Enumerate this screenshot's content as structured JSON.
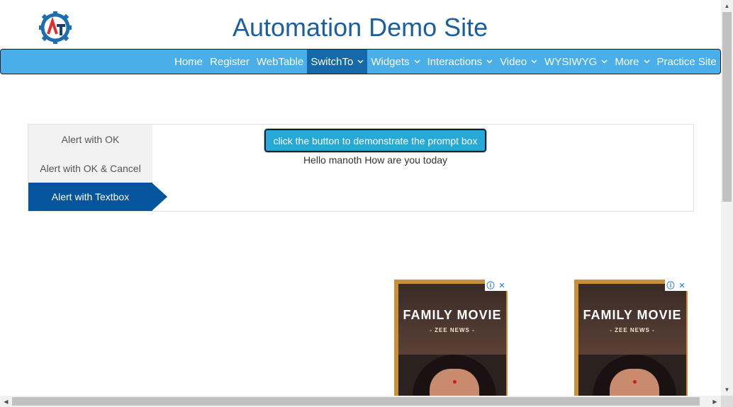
{
  "header": {
    "site_title": "Automation Demo Site",
    "logo_letters": "AT"
  },
  "nav": {
    "items": [
      {
        "label": "Home",
        "active": false,
        "dropdown": false
      },
      {
        "label": "Register",
        "active": false,
        "dropdown": false
      },
      {
        "label": "WebTable",
        "active": false,
        "dropdown": false
      },
      {
        "label": "SwitchTo",
        "active": true,
        "dropdown": true
      },
      {
        "label": "Widgets",
        "active": false,
        "dropdown": true
      },
      {
        "label": "Interactions",
        "active": false,
        "dropdown": true
      },
      {
        "label": "Video",
        "active": false,
        "dropdown": true
      },
      {
        "label": "WYSIWYG",
        "active": false,
        "dropdown": true
      },
      {
        "label": "More",
        "active": false,
        "dropdown": true
      },
      {
        "label": "Practice Site",
        "active": false,
        "dropdown": false
      }
    ],
    "colors": {
      "bar": "#4aaee8",
      "active": "#1569a8"
    }
  },
  "tabs": {
    "items": [
      {
        "label": "Alert with OK",
        "selected": false
      },
      {
        "label": "Alert with OK & Cancel",
        "selected": false
      },
      {
        "label": "Alert with Textbox",
        "selected": true
      }
    ],
    "selected_color": "#04559b"
  },
  "content": {
    "button_label": "click the button to demonstrate the prompt box",
    "result_text": "Hello manoth How are you today"
  },
  "ads": [
    {
      "headline": "FAMILY MOVIE",
      "subline": "- ZEE NEWS -",
      "info_icon": "info-icon",
      "close_icon": "close-icon"
    },
    {
      "headline": "FAMILY MOVIE",
      "subline": "- ZEE NEWS -",
      "info_icon": "info-icon",
      "close_icon": "close-icon"
    }
  ]
}
